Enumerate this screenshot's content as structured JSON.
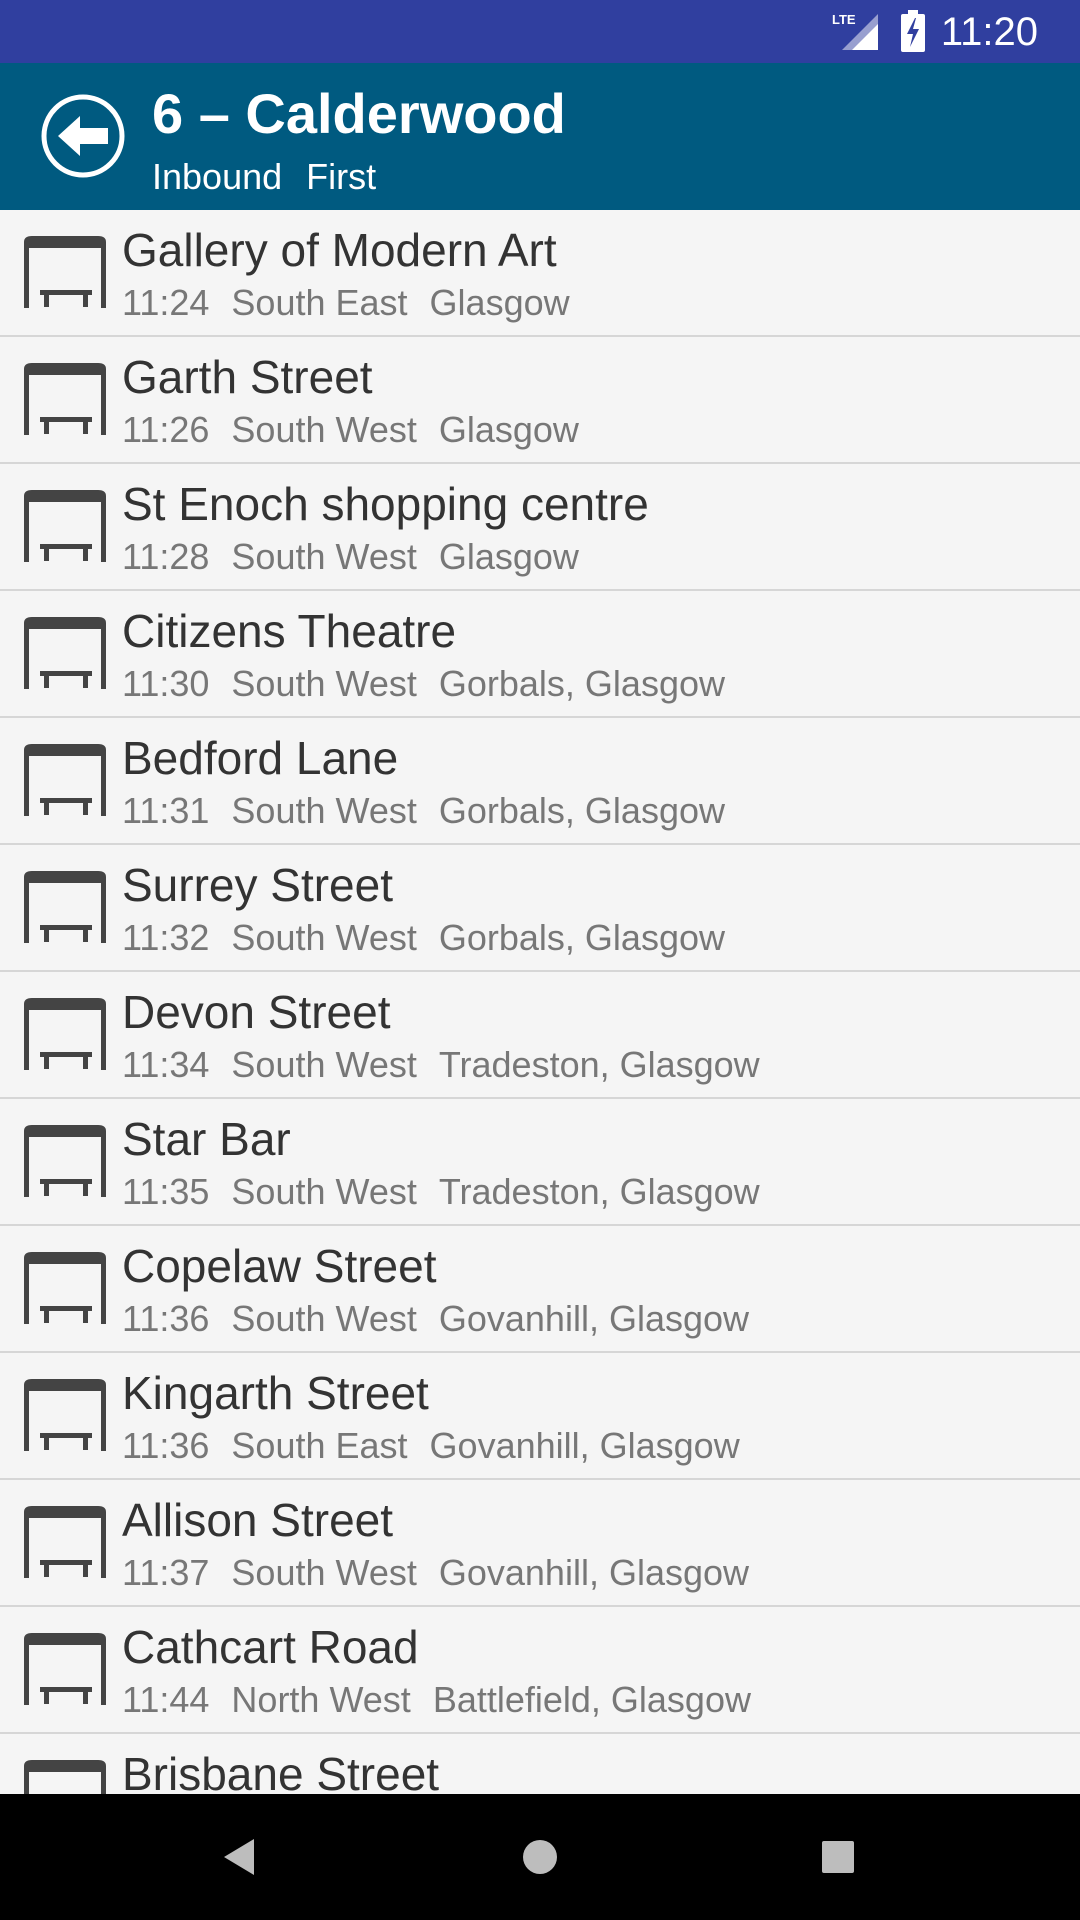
{
  "status_bar": {
    "network": "LTE",
    "time": "11:20",
    "icons": [
      "lte-signal-icon",
      "battery-charging-icon"
    ]
  },
  "header": {
    "title": "6 – Calderwood",
    "direction": "Inbound",
    "operator": "First",
    "back_icon": "back-arrow-icon"
  },
  "stops": [
    {
      "name": "Gallery of Modern Art",
      "time": "11:24",
      "bearing": "South East",
      "locality": "Glasgow"
    },
    {
      "name": "Garth Street",
      "time": "11:26",
      "bearing": "South West",
      "locality": "Glasgow"
    },
    {
      "name": "St Enoch shopping centre",
      "time": "11:28",
      "bearing": "South West",
      "locality": "Glasgow"
    },
    {
      "name": "Citizens Theatre",
      "time": "11:30",
      "bearing": "South West",
      "locality": "Gorbals, Glasgow"
    },
    {
      "name": "Bedford Lane",
      "time": "11:31",
      "bearing": "South West",
      "locality": "Gorbals, Glasgow"
    },
    {
      "name": "Surrey Street",
      "time": "11:32",
      "bearing": "South West",
      "locality": "Gorbals, Glasgow"
    },
    {
      "name": "Devon Street",
      "time": "11:34",
      "bearing": "South West",
      "locality": "Tradeston, Glasgow"
    },
    {
      "name": "Star Bar",
      "time": "11:35",
      "bearing": "South West",
      "locality": "Tradeston, Glasgow"
    },
    {
      "name": "Copelaw Street",
      "time": "11:36",
      "bearing": "South West",
      "locality": "Govanhill, Glasgow"
    },
    {
      "name": "Kingarth Street",
      "time": "11:36",
      "bearing": "South East",
      "locality": "Govanhill, Glasgow"
    },
    {
      "name": "Allison Street",
      "time": "11:37",
      "bearing": "South West",
      "locality": "Govanhill, Glasgow"
    },
    {
      "name": "Cathcart Road",
      "time": "11:44",
      "bearing": "North West",
      "locality": "Battlefield, Glasgow"
    },
    {
      "name": "Brisbane Street",
      "time": "",
      "bearing": "",
      "locality": ""
    }
  ],
  "nav_bar": {
    "icons": [
      "back-triangle-icon",
      "home-circle-icon",
      "recents-square-icon"
    ]
  },
  "colors": {
    "status_bar": "#303f9f",
    "app_bar": "#005a80",
    "list_background": "#f5f5f5",
    "stop_name": "#333333",
    "stop_meta": "#777777",
    "divider": "#d6d6d6"
  }
}
